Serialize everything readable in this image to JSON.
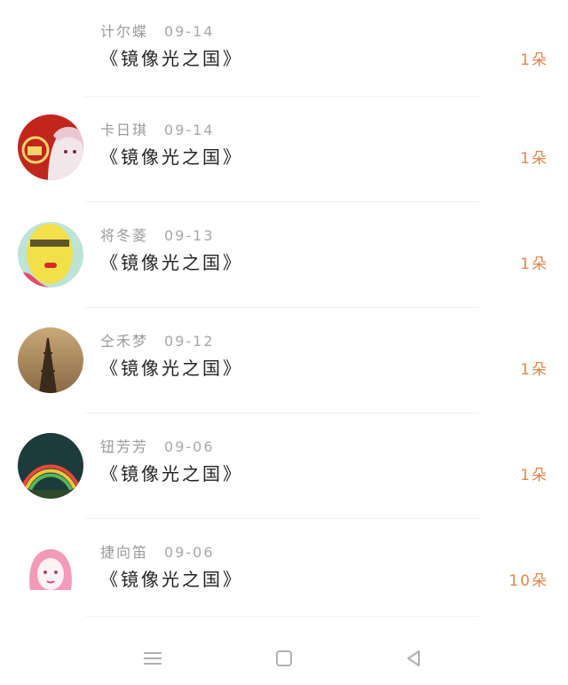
{
  "rows": [
    {
      "name": "计尔蝶",
      "date": "09-14",
      "title": "《镜像光之国》",
      "count": "1朵",
      "avatar": "none"
    },
    {
      "name": "卡日琪",
      "date": "09-14",
      "title": "《镜像光之国》",
      "count": "1朵",
      "avatar": "anime-girl-red"
    },
    {
      "name": "将冬菱",
      "date": "09-13",
      "title": "《镜像光之国》",
      "count": "1朵",
      "avatar": "yellow-face-art"
    },
    {
      "name": "仝禾梦",
      "date": "09-12",
      "title": "《镜像光之国》",
      "count": "1朵",
      "avatar": "tower-sepia"
    },
    {
      "name": "钮芳芳",
      "date": "09-06",
      "title": "《镜像光之国》",
      "count": "1朵",
      "avatar": "rainbow-sky"
    },
    {
      "name": "捷向笛",
      "date": "09-06",
      "title": "《镜像光之国》",
      "count": "10朵",
      "avatar": "pink-hair-sketch"
    }
  ],
  "colors": {
    "accent": "#e0864a",
    "meta": "#9a9a9a",
    "title": "#222222"
  },
  "navbar": {
    "icons": [
      "menu-icon",
      "home-square-icon",
      "back-triangle-icon"
    ]
  }
}
